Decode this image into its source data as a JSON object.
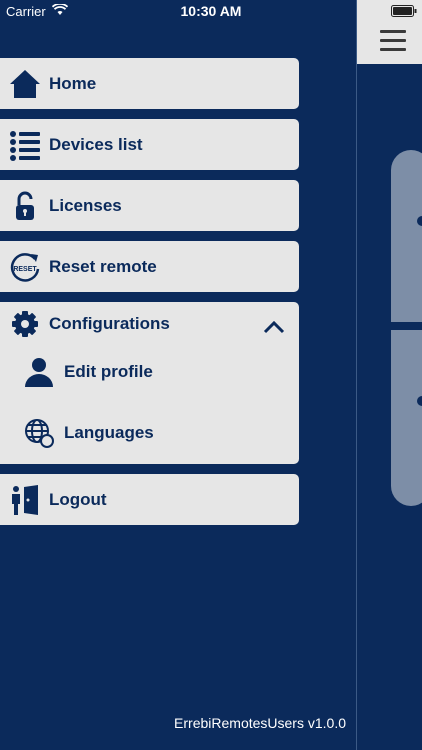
{
  "status_bar": {
    "carrier": "Carrier",
    "time": "10:30 AM"
  },
  "menu": {
    "items": [
      {
        "label": "Home",
        "icon": "home-icon"
      },
      {
        "label": "Devices list",
        "icon": "list-icon"
      },
      {
        "label": "Licenses",
        "icon": "lock-icon"
      },
      {
        "label": "Reset remote",
        "icon": "reset-icon",
        "icon_text": "RESET"
      }
    ],
    "configurations": {
      "label": "Configurations",
      "icon": "gear-icon",
      "expanded": true,
      "sub_items": [
        {
          "label": "Edit profile",
          "icon": "user-icon"
        },
        {
          "label": "Languages",
          "icon": "globe-icon"
        }
      ]
    },
    "logout": {
      "label": "Logout",
      "icon": "logout-icon"
    }
  },
  "footer": {
    "version": "ErrebiRemotesUsers v1.0.0"
  },
  "colors": {
    "primary": "#0b2a5b",
    "menu_bg": "#e6e6e6",
    "card": "#7d8ea7"
  }
}
